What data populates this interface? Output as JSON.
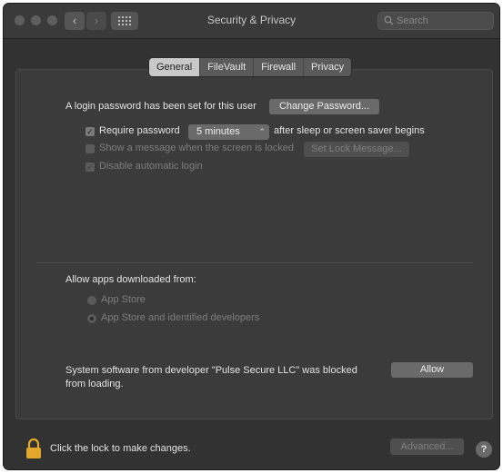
{
  "window": {
    "title": "Security & Privacy",
    "search_placeholder": "Search",
    "back_glyph": "‹",
    "forward_glyph": "›"
  },
  "tabs": [
    {
      "label": "General",
      "active": true
    },
    {
      "label": "FileVault",
      "active": false
    },
    {
      "label": "Firewall",
      "active": false
    },
    {
      "label": "Privacy",
      "active": false
    }
  ],
  "general": {
    "login_text": "A login password has been set for this user",
    "change_password_label": "Change Password...",
    "require_password_label": "Require password",
    "require_password_checked": true,
    "require_password_delay": "5 minutes",
    "after_sleep_text": "after sleep or screen saver begins",
    "show_message_label": "Show a message when the screen is locked",
    "show_message_checked": false,
    "set_lock_message_label": "Set Lock Message...",
    "disable_login_label": "Disable automatic login",
    "disable_login_checked": true
  },
  "apps": {
    "heading": "Allow apps downloaded from:",
    "options": [
      {
        "label": "App Store",
        "selected": false
      },
      {
        "label": "App Store and identified developers",
        "selected": true
      }
    ]
  },
  "blocked": {
    "message_line1": "System software from developer \"Pulse Secure LLC\" was blocked",
    "message_line2": "from loading.",
    "allow_label": "Allow"
  },
  "footer": {
    "lock_text": "Click the lock to make changes.",
    "advanced_label": "Advanced...",
    "help_label": "?"
  },
  "colors": {
    "window_bg": "#323232",
    "panel_bg": "#3b3b3b",
    "lock_gold": "#e3a82b"
  }
}
